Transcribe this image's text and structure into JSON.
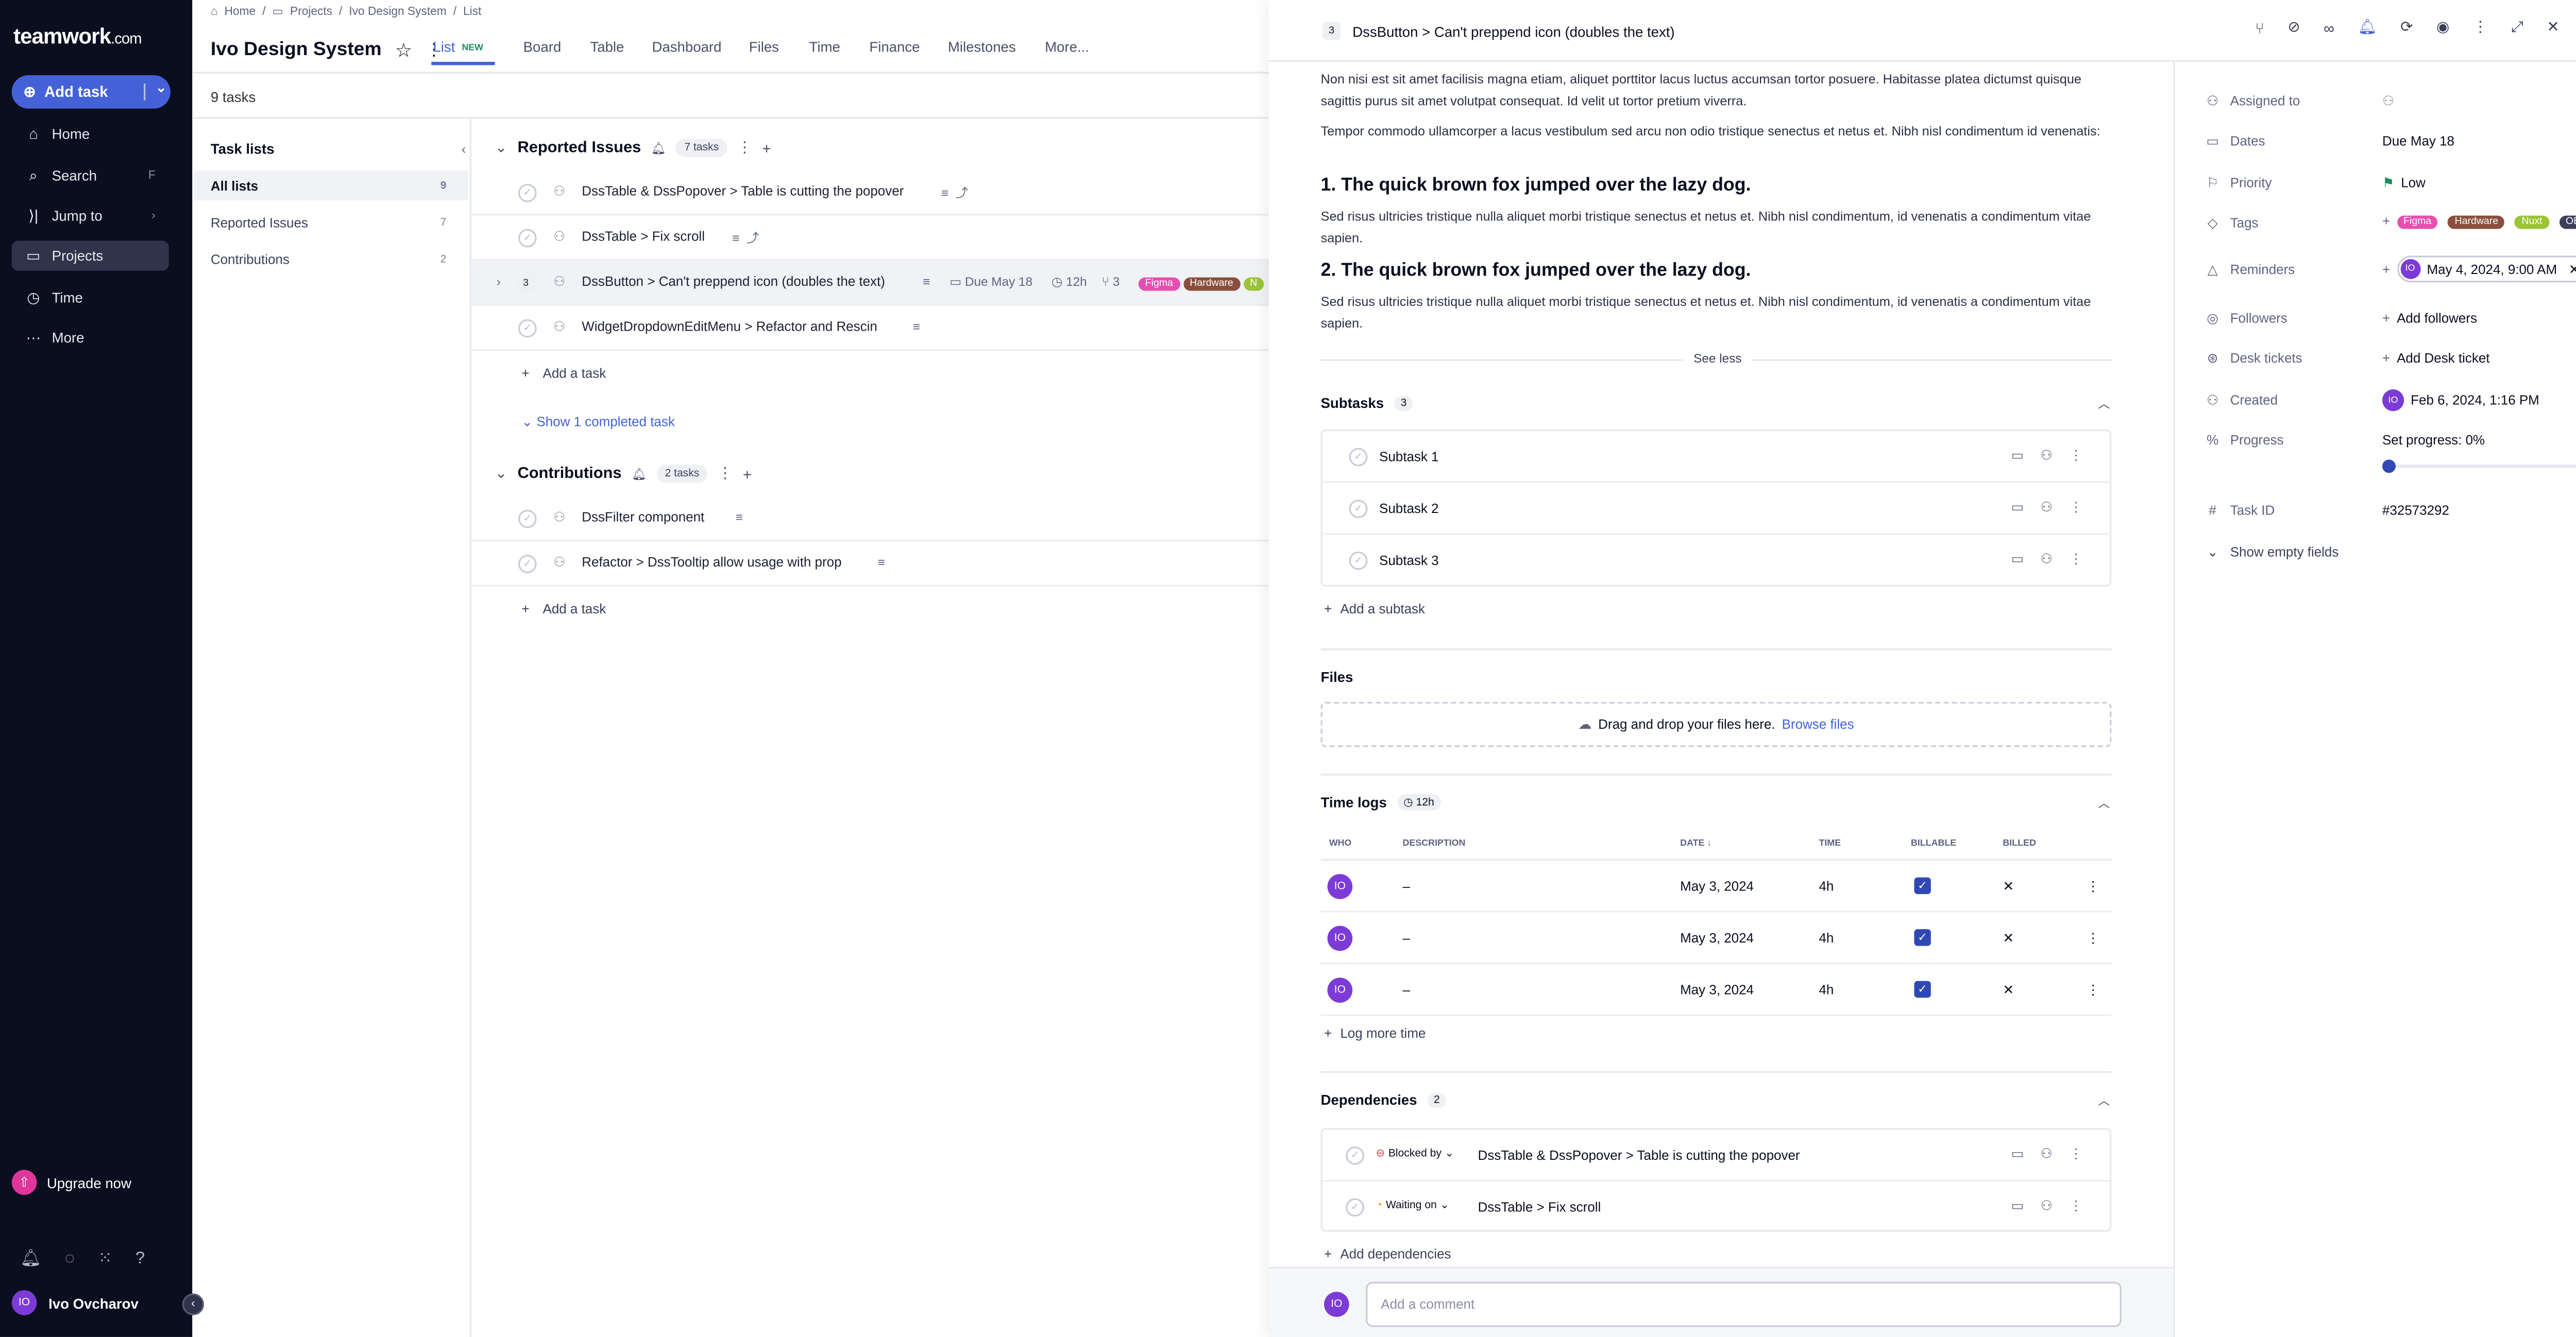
{
  "app": {
    "logo": "teamwork",
    "logo_suffix": ".com"
  },
  "sidebar": {
    "add_task": "Add task",
    "items": [
      {
        "label": "Home",
        "key": "",
        "icon": "home-icon"
      },
      {
        "label": "Search",
        "key": "F",
        "icon": "search-icon"
      },
      {
        "label": "Jump to",
        "key": "›",
        "icon": "jump-icon"
      },
      {
        "label": "Projects",
        "key": "",
        "icon": "folder-icon"
      },
      {
        "label": "Time",
        "key": "",
        "icon": "clock-icon"
      },
      {
        "label": "More",
        "key": "",
        "icon": "more-icon"
      }
    ],
    "upgrade": "Upgrade now",
    "user_initials": "IO",
    "user_name": "Ivo Ovcharov"
  },
  "breadcrumb": [
    "Home",
    "Projects",
    "Ivo Design System",
    "List"
  ],
  "project": {
    "title": "Ivo Design System",
    "task_count": "9 tasks"
  },
  "tabs": [
    {
      "label": "List",
      "badge": "NEW"
    },
    {
      "label": "Board"
    },
    {
      "label": "Table"
    },
    {
      "label": "Dashboard"
    },
    {
      "label": "Files"
    },
    {
      "label": "Time"
    },
    {
      "label": "Finance"
    },
    {
      "label": "Milestones"
    },
    {
      "label": "More..."
    }
  ],
  "tasklists": {
    "heading": "Task lists",
    "items": [
      {
        "label": "All lists",
        "count": "9"
      },
      {
        "label": "Reported Issues",
        "count": "7"
      },
      {
        "label": "Contributions",
        "count": "2"
      }
    ]
  },
  "groups": [
    {
      "title": "Reported Issues",
      "count": "7 tasks",
      "tasks": [
        {
          "title": "DssTable & DssPopover > Table is cutting the popover"
        },
        {
          "title": "DssTable > Fix scroll"
        },
        {
          "title": "DssButton > Can't preppend icon (doubles the text)",
          "num": "3",
          "due": "Due May 18",
          "time": "12h",
          "subtasks": "3",
          "tags": [
            "Figma",
            "Hardware",
            "N"
          ]
        },
        {
          "title": "WidgetDropdownEditMenu > Refactor and Rescin"
        }
      ],
      "add": "Add a task",
      "show_completed": "Show 1 completed task"
    },
    {
      "title": "Contributions",
      "count": "2 tasks",
      "tasks": [
        {
          "title": "DssFilter component"
        },
        {
          "title": "Refactor > DssTooltip allow usage with prop"
        }
      ],
      "add": "Add a task"
    }
  ],
  "panel": {
    "num": "3",
    "title": "DssButton > Can't preppend icon (doubles the text)",
    "desc1": "Non nisi est sit amet facilisis magna etiam, aliquet porttitor lacus luctus accumsan tortor posuere. Habitasse platea dictumst quisque sagittis purus sit amet volutpat consequat. Id velit ut tortor pretium viverra.",
    "desc2": "Tempor commodo ullamcorper a lacus vestibulum sed arcu non odio tristique senectus et netus et. Nibh nisl condimentum id venenatis:",
    "h1": "1. The quick brown fox jumped over the lazy dog.",
    "desc3": "Sed risus ultricies tristique nulla aliquet morbi tristique senectus et netus et. Nibh nisl condimentum, id venenatis a condimentum vitae sapien.",
    "h2": "2. The quick brown fox jumped over the lazy dog.",
    "desc4": "Sed risus ultricies tristique nulla aliquet morbi tristique senectus et netus et. Nibh nisl condimentum, id venenatis a condimentum vitae sapien.",
    "see_less": "See less",
    "subtasks_title": "Subtasks",
    "subtasks_count": "3",
    "subtasks": [
      "Subtask 1",
      "Subtask 2",
      "Subtask 3"
    ],
    "add_subtask": "Add a subtask",
    "files_title": "Files",
    "drop_text": "Drag and drop your files here.",
    "browse": "Browse files",
    "timelogs_title": "Time logs",
    "timelogs_total": "12h",
    "tl_headers": {
      "who": "WHO",
      "desc": "DESCRIPTION",
      "date": "DATE",
      "time": "TIME",
      "billable": "BILLABLE",
      "billed": "BILLED"
    },
    "timelogs": [
      {
        "who": "IO",
        "desc": "–",
        "date": "May 3, 2024",
        "time": "4h"
      },
      {
        "who": "IO",
        "desc": "–",
        "date": "May 3, 2024",
        "time": "4h"
      },
      {
        "who": "IO",
        "desc": "–",
        "date": "May 3, 2024",
        "time": "4h"
      }
    ],
    "log_more": "Log more time",
    "deps_title": "Dependencies",
    "deps_count": "2",
    "deps": [
      {
        "status": "Blocked by",
        "title": "DssTable & DssPopover > Table is cutting the popover",
        "color": "#d93f3f"
      },
      {
        "status": "Waiting on",
        "title": "DssTable > Fix scroll",
        "color": "#e2a012"
      }
    ],
    "add_deps": "Add dependencies",
    "comment_placeholder": "Add a comment",
    "comment_avatar": "IO"
  },
  "props": {
    "assigned_label": "Assigned to",
    "dates_label": "Dates",
    "dates_value": "Due May 18",
    "priority_label": "Priority",
    "priority_value": "Low",
    "tags_label": "Tags",
    "tags": [
      {
        "name": "Figma",
        "color": "#e64fb0"
      },
      {
        "name": "Hardware",
        "color": "#8a4f3c"
      },
      {
        "name": "Nuxt",
        "color": "#9bc43a"
      },
      {
        "name": "OBS",
        "color": "#3a3f5a"
      }
    ],
    "reminders_label": "Reminders",
    "reminder_value": "May 4, 2024, 9:00 AM",
    "reminder_initials": "IO",
    "followers_label": "Followers",
    "followers_value": "Add followers",
    "desk_label": "Desk tickets",
    "desk_value": "Add Desk ticket",
    "created_label": "Created",
    "created_value": "Feb 6, 2024, 1:16 PM",
    "created_initials": "IO",
    "progress_label": "Progress",
    "progress_value": "Set progress: 0%",
    "progress": 0,
    "taskid_label": "Task ID",
    "taskid_value": "#32573292",
    "show_empty": "Show empty fields"
  }
}
